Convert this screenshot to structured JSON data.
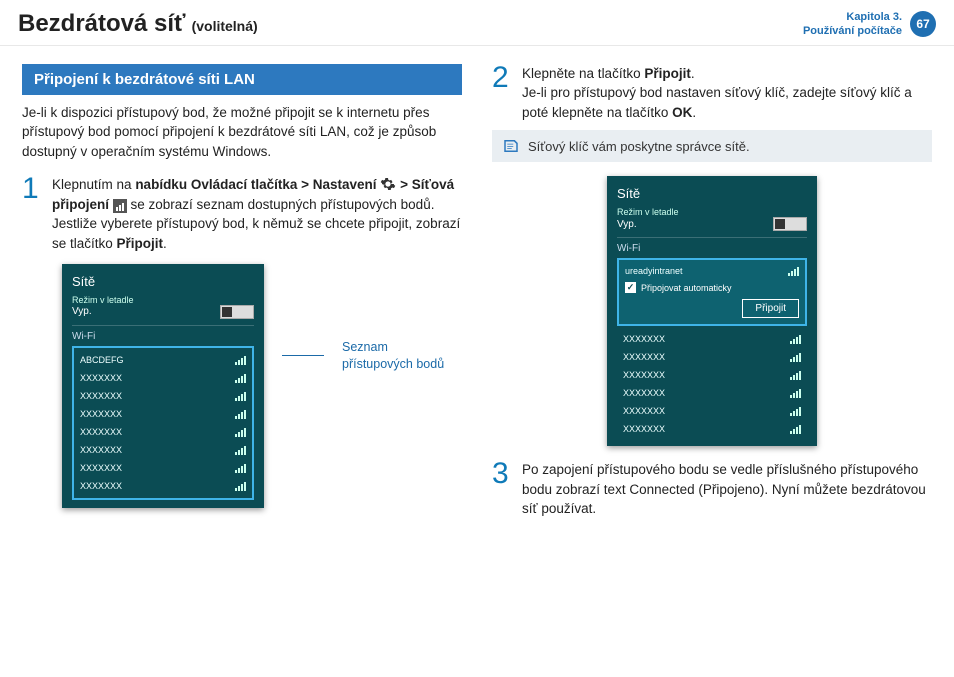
{
  "header": {
    "title": "Bezdrátová síť",
    "subtitle": "(volitelná)",
    "chapter_line1": "Kapitola 3.",
    "chapter_line2": "Používání počítače",
    "page_number": "67"
  },
  "left": {
    "section_title": "Připojení k bezdrátové síti LAN",
    "intro": "Je-li k dispozici přístupový bod, že možné připojit se k internetu přes přístupový bod pomocí připojení k bezdrátové síti LAN, což je způsob dostupný v operačním systému Windows.",
    "step1": {
      "num": "1",
      "part1": "Klepnutím na ",
      "bold1": "nabídku Ovládací tlačítka > Nastavení",
      "part2": " > ",
      "bold2": "Síťová připojení",
      "part3": " se zobrazí seznam dostupných přístupových bodů. Jestliže vyberete přístupový bod, k němuž se chcete připojit, zobrazí se tlačítko ",
      "bold3": "Připojit",
      "part4": "."
    },
    "callout": "Seznam přístupových bodů",
    "panel": {
      "title": "Sítě",
      "airplane_label": "Režim v letadle",
      "airplane_state": "Vyp.",
      "wifi_label": "Wi-Fi",
      "items": [
        "ABCDEFG",
        "XXXXXXX",
        "XXXXXXX",
        "XXXXXXX",
        "XXXXXXX",
        "XXXXXXX",
        "XXXXXXX",
        "XXXXXXX"
      ]
    }
  },
  "right": {
    "step2": {
      "num": "2",
      "line1a": "Klepněte na tlačítko ",
      "line1b": "Připojit",
      "line1c": ".",
      "line2a": "Je-li pro přístupový bod nastaven síťový klíč, zadejte síťový klíč a poté klepněte na tlačítko ",
      "line2b": "OK",
      "line2c": "."
    },
    "note": "Síťový klíč vám poskytne správce sítě.",
    "panel": {
      "title": "Sítě",
      "airplane_label": "Režim v letadle",
      "airplane_state": "Vyp.",
      "wifi_label": "Wi-Fi",
      "selected_name": "ureadyintranet",
      "auto_connect": "Připojovat automaticky",
      "connect_btn": "Připojit",
      "items": [
        "XXXXXXX",
        "XXXXXXX",
        "XXXXXXX",
        "XXXXXXX",
        "XXXXXXX",
        "XXXXXXX"
      ]
    },
    "step3": {
      "num": "3",
      "text": "Po zapojení přístupového bodu se vedle příslušného přístupového bodu zobrazí text Connected (Připojeno). Nyní můžete bezdrátovou síť používat."
    }
  }
}
